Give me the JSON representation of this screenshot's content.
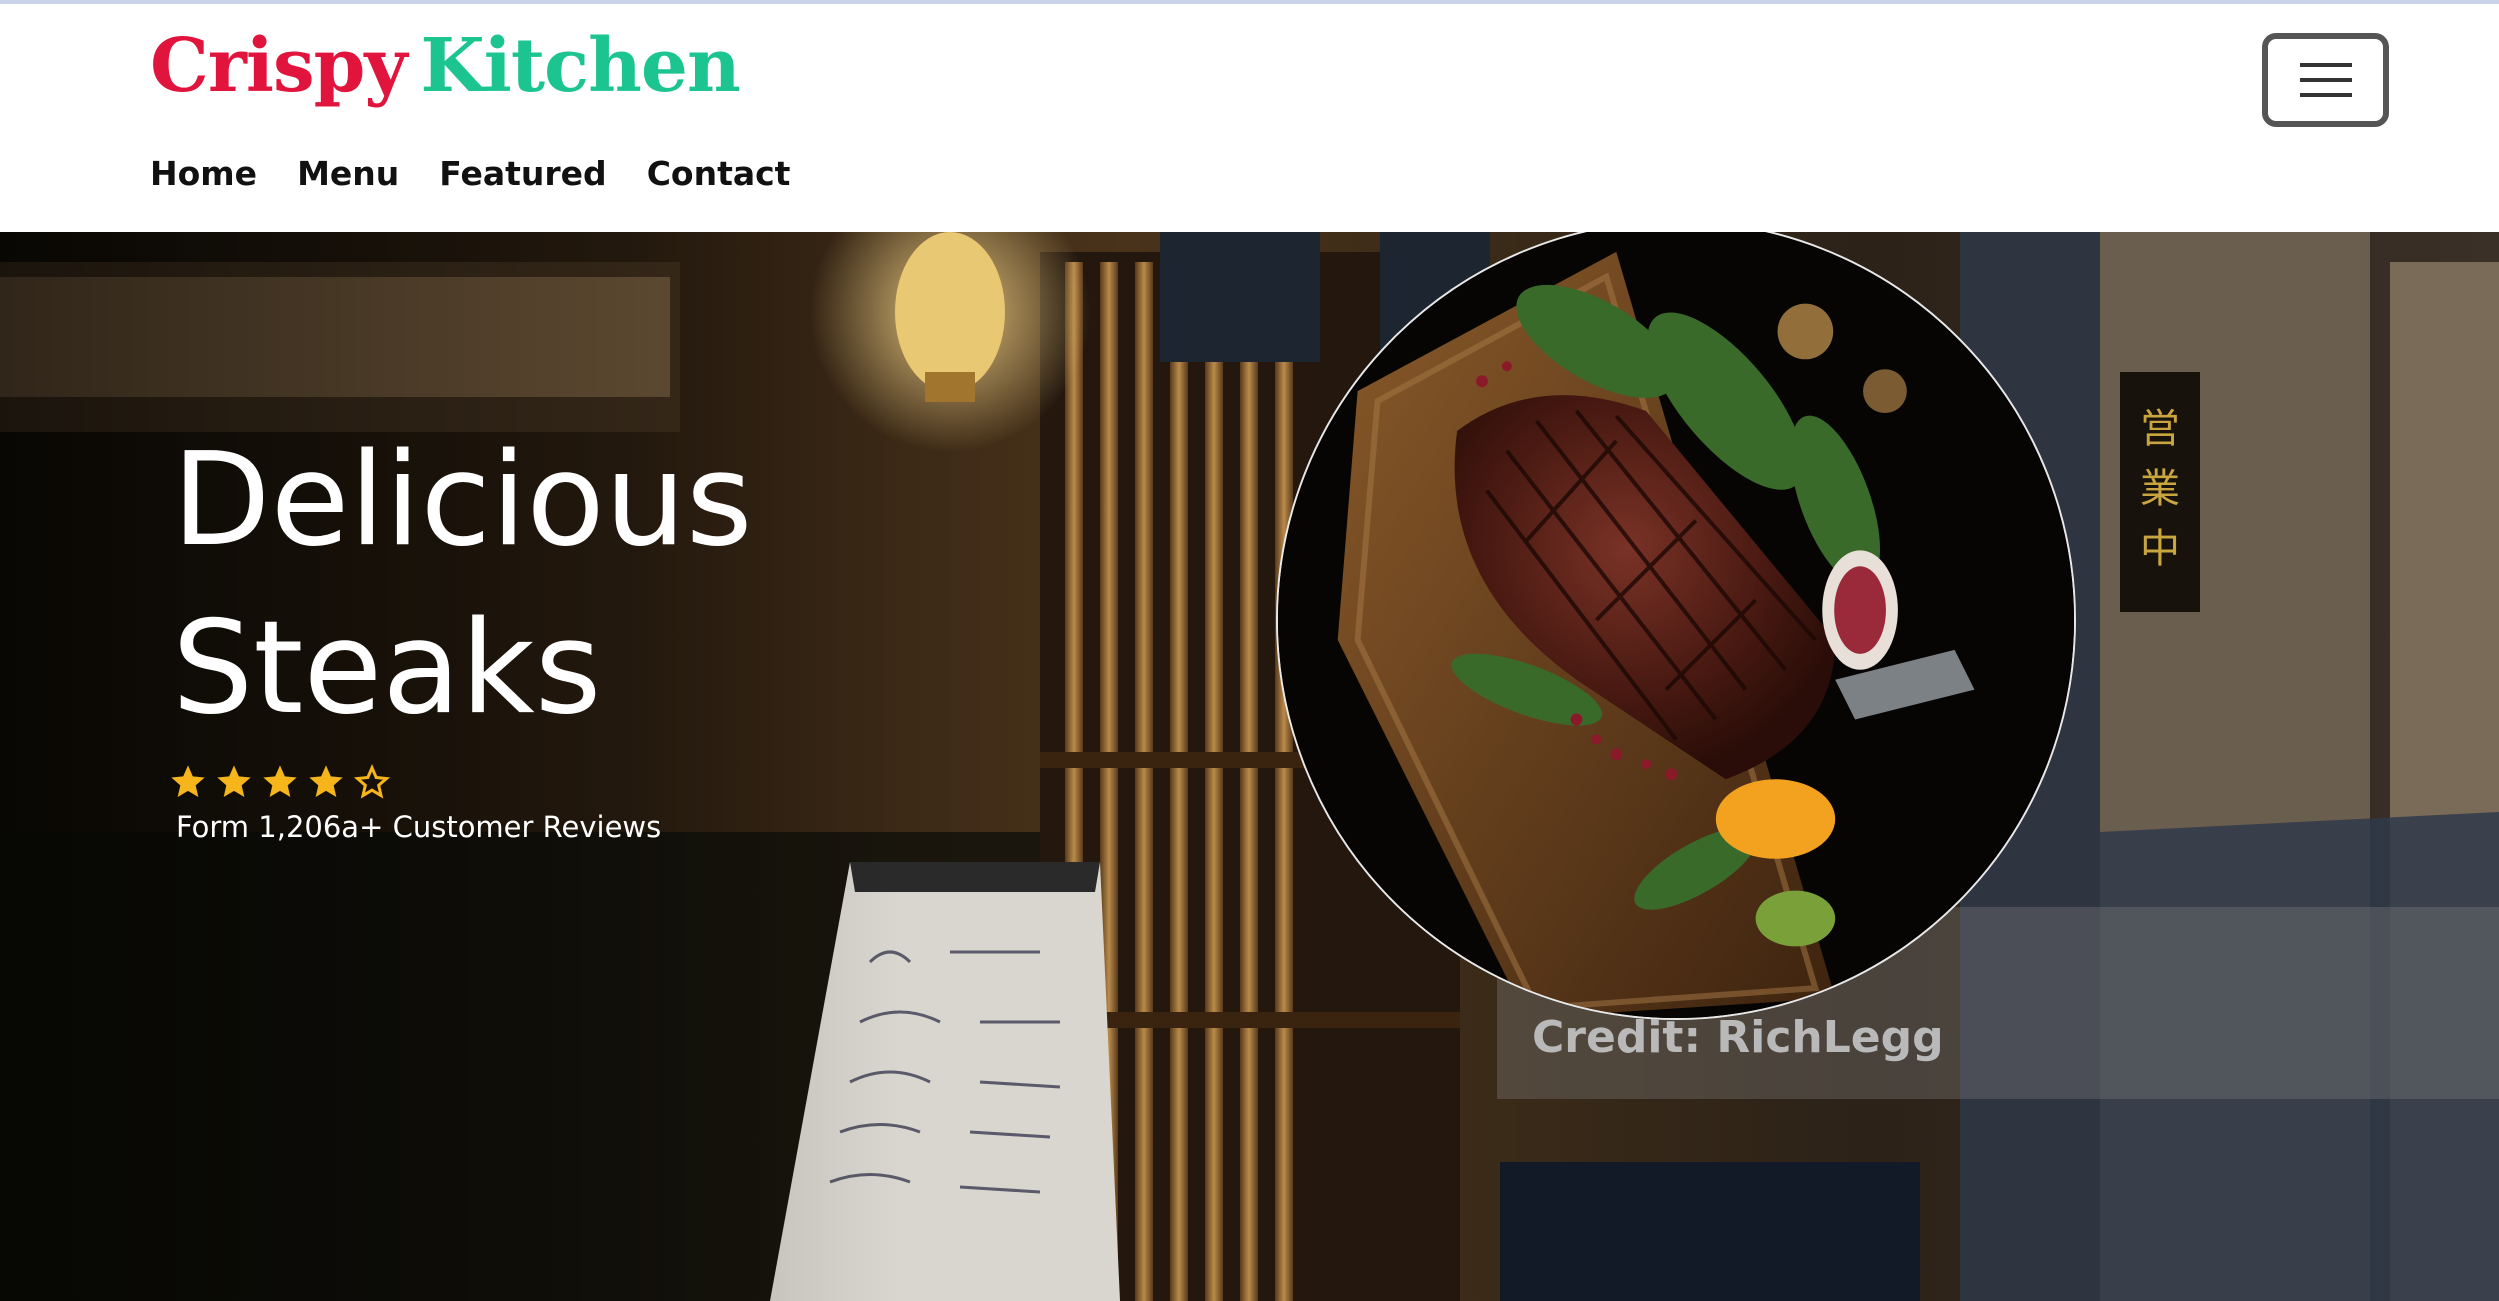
{
  "brand": {
    "word1": "Crispy",
    "word2": "Kitchen",
    "color1": "#e0143c",
    "color2": "#1cc58f"
  },
  "nav": {
    "items": [
      "Home",
      "Menu",
      "Featured",
      "Contact"
    ]
  },
  "menu_toggle": {
    "icon": "hamburger-icon"
  },
  "hero": {
    "title_line1": "Delicious",
    "title_line2": "Steaks",
    "rating": 4,
    "rating_max": 5,
    "star_color": "#f5b51b",
    "reviews": "Form 1,206a+ Customer Reviews",
    "image_icon": "steak-on-board-image"
  },
  "credit": "Credit: RichLegg"
}
